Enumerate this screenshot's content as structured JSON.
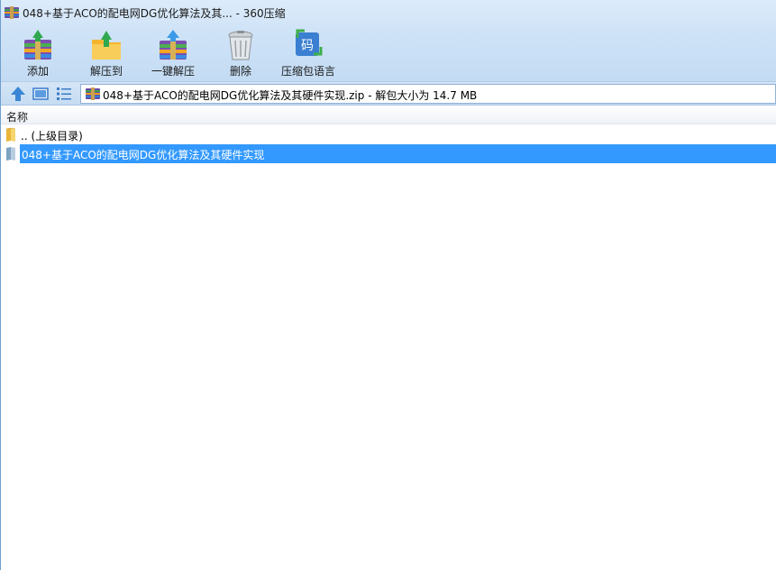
{
  "window": {
    "title": "048+基于ACO的配电网DG优化算法及其... - 360压缩"
  },
  "toolbar": {
    "add_label": "添加",
    "extract_to_label": "解压到",
    "one_click_extract_label": "一键解压",
    "delete_label": "删除",
    "archive_language_label": "压缩包语言",
    "archive_language_glyph": "码"
  },
  "address": {
    "path": "048+基于ACO的配电网DG优化算法及其硬件实现.zip - 解包大小为 14.7 MB"
  },
  "list": {
    "column_name": "名称",
    "items": [
      {
        "label": ".. (上级目录)",
        "icon": "folder-icon",
        "selected": false
      },
      {
        "label": "048+基于ACO的配电网DG优化算法及其硬件实现",
        "icon": "folder-icon",
        "selected": true
      }
    ]
  },
  "colors": {
    "selection": "#3399ff",
    "toolbar_bg": "#cfe3f7"
  }
}
